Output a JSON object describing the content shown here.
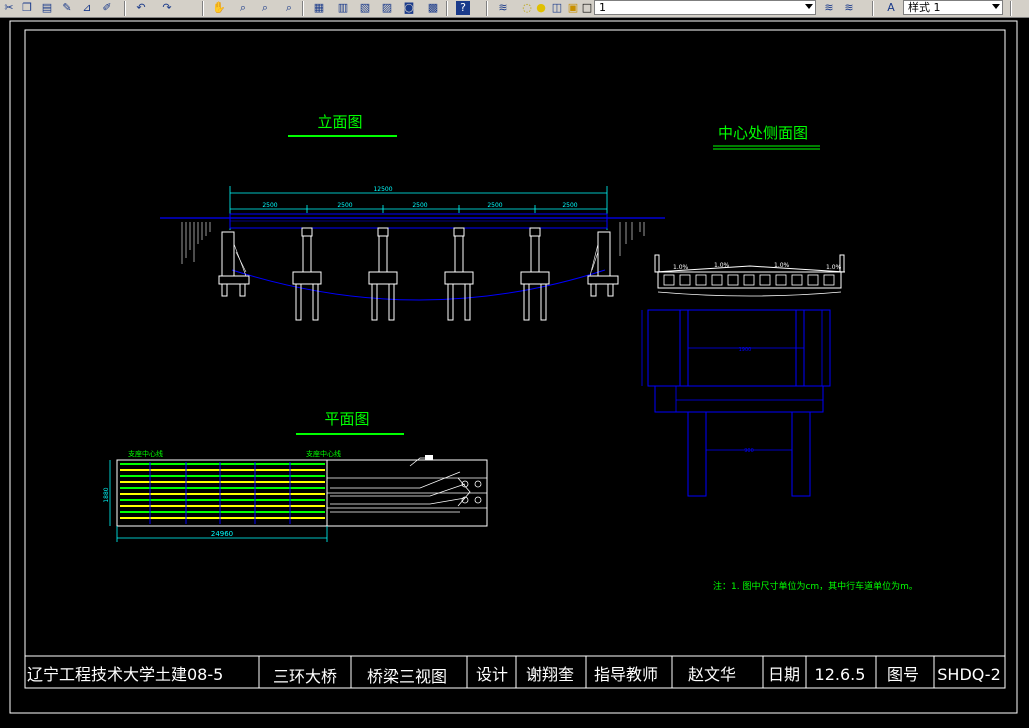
{
  "toolbar": {
    "icons": [
      "cut-icon",
      "copy-icon",
      "paste-icon",
      "match-properties-icon",
      "paint-icon",
      "undo-icon",
      "redo-icon",
      "pan-icon",
      "zoom-realtime-icon",
      "zoom-window-icon",
      "zoom-previous-icon",
      "properties-icon",
      "design-center-icon",
      "tool-palettes-icon",
      "sheet-set-icon",
      "markup-icon",
      "calculator-icon",
      "help-icon",
      "layer-manager-icon",
      "bulb-icon",
      "sun-icon",
      "freeze-icon",
      "lock-icon",
      "color-swatch-icon",
      "layer-previous-icon",
      "layer-states-icon",
      "text-style-icon"
    ],
    "layer_value": "1",
    "style_value": "样式 1"
  },
  "drawing": {
    "elevation_title": "立面图",
    "side_title": "中心处侧面图",
    "plan_title": "平面图",
    "total_span_dim": "12500",
    "span_dims": [
      "2500",
      "2500",
      "2500",
      "2500",
      "2500"
    ],
    "side_slopes": [
      "1.0%",
      "1.0%",
      "1.0%",
      "1.0%"
    ],
    "plan_label_left": "支座中心线",
    "plan_label_right": "支座中心线",
    "plan_width_dim": "1880",
    "plan_length_dim": "24960",
    "note": "注：1. 图中尺寸单位为cm，其中行车道单位为m。"
  },
  "title_block": {
    "school": "辽宁工程技术大学土建08-5",
    "project": "三环大桥",
    "drawing_name": "桥梁三视图",
    "design_label": "设计",
    "designer": "谢翔奎",
    "advisor_label": "指导教师",
    "advisor": "赵文华",
    "date_label": "日期",
    "date": "12.6.5",
    "drawing_no_label": "图号",
    "drawing_no": "SHDQ-2"
  },
  "colors": {
    "title_green": "#00ff00",
    "line_blue": "#0000ff",
    "dim_cyan": "#00ffff",
    "white": "#ffffff",
    "yellow": "#ffff00"
  }
}
